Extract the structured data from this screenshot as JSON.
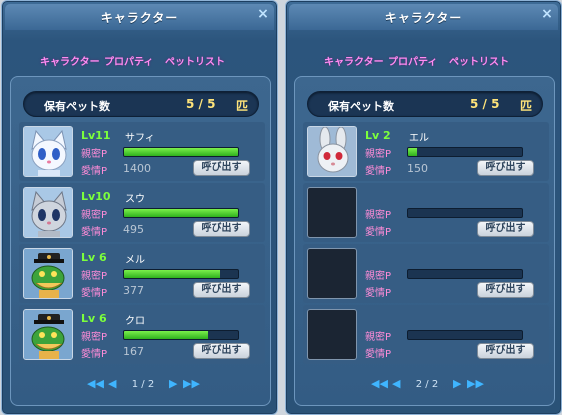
{
  "windows": [
    {
      "title": "キャラクター",
      "tabs": [
        "キャラクター",
        "プロパティ",
        "ペットリスト"
      ],
      "count_label": "保有ペット数",
      "count_value": "5 / 5",
      "count_unit": "匹",
      "slots": [
        {
          "level": "Lv11",
          "name": "サフィ",
          "intimacy_label": "親密P",
          "affection_label": "愛情P",
          "intimacy_pct": 100,
          "affection": "1400",
          "button": "呼び出す",
          "pet": "white-cat"
        },
        {
          "level": "Lv10",
          "name": "スウ",
          "intimacy_label": "親密P",
          "affection_label": "愛情P",
          "intimacy_pct": 100,
          "affection": "495",
          "button": "呼び出す",
          "pet": "gray-cat"
        },
        {
          "level": "Lv 6",
          "name": "メル",
          "intimacy_label": "親密P",
          "affection_label": "愛情P",
          "intimacy_pct": 84,
          "affection": "377",
          "button": "呼び出す",
          "pet": "green-dragon"
        },
        {
          "level": "Lv 6",
          "name": "クロ",
          "intimacy_label": "親密P",
          "affection_label": "愛情P",
          "intimacy_pct": 74,
          "affection": "167",
          "button": "呼び出す",
          "pet": "green-dragon"
        }
      ],
      "page": "1 / 2"
    },
    {
      "title": "キャラクター",
      "tabs": [
        "キャラクター",
        "プロパティ",
        "ペットリスト"
      ],
      "count_label": "保有ペット数",
      "count_value": "5 / 5",
      "count_unit": "匹",
      "slots": [
        {
          "level": "Lv 2",
          "name": "エル",
          "intimacy_label": "親密P",
          "affection_label": "愛情P",
          "intimacy_pct": 8,
          "affection": "150",
          "button": "呼び出す",
          "pet": "rabbit"
        },
        {
          "level": "",
          "name": "",
          "intimacy_label": "親密P",
          "affection_label": "愛情P",
          "intimacy_pct": 0,
          "affection": "",
          "button": "呼び出す",
          "pet": "empty"
        },
        {
          "level": "",
          "name": "",
          "intimacy_label": "親密P",
          "affection_label": "愛情P",
          "intimacy_pct": 0,
          "affection": "",
          "button": "呼び出す",
          "pet": "empty"
        },
        {
          "level": "",
          "name": "",
          "intimacy_label": "親密P",
          "affection_label": "愛情P",
          "intimacy_pct": 0,
          "affection": "",
          "button": "呼び出す",
          "pet": "empty"
        }
      ],
      "page": "2 / 2"
    }
  ],
  "icons": {
    "close": "close-icon",
    "first": "first-page-icon",
    "prev": "prev-page-icon",
    "next": "next-page-icon",
    "last": "last-page-icon"
  },
  "colors": {
    "level": "#7cff3c",
    "tab": "#ff8cf2",
    "label": "#ff8cd8",
    "count": "#ffe47a",
    "bar": "#3fc12a"
  }
}
